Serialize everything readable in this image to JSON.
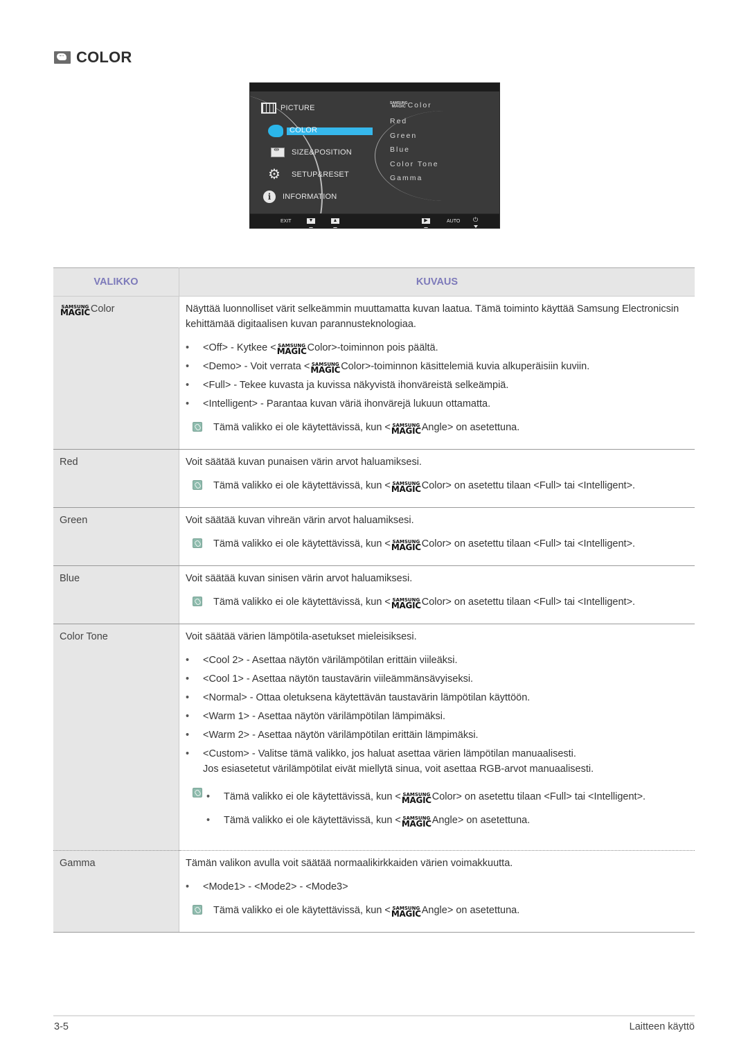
{
  "page": {
    "title": "COLOR",
    "title_icon": "color-palette-icon"
  },
  "osd": {
    "menu_items": [
      {
        "label": "PICTURE",
        "icon": "picture-icon",
        "selected": false
      },
      {
        "label": "COLOR",
        "icon": "color-icon",
        "selected": true
      },
      {
        "label": "SIZE&POSITION",
        "icon": "size-position-icon",
        "selected": false
      },
      {
        "label": "SETUP&RESET",
        "icon": "gear-icon",
        "selected": false
      },
      {
        "label": "INFORMATION",
        "icon": "info-icon",
        "selected": false
      }
    ],
    "submenu_brand_top": "SAMSUNG",
    "submenu_brand_bottom": "MAGIC",
    "submenu_items": [
      "Color",
      "Red",
      "Green",
      "Blue",
      "Color Tone",
      "Gamma"
    ],
    "buttons": {
      "exit": "EXIT",
      "down": "▼",
      "up": "▲",
      "right": "▶",
      "auto": "AUTO",
      "power": "⏻"
    },
    "selected_color": "#36b8ec"
  },
  "brand": {
    "top": "SAMSUNG",
    "bottom": "MAGIC"
  },
  "table": {
    "headers": {
      "menu": "VALIKKO",
      "description": "KUVAUS"
    },
    "header_color": "#7d7aba",
    "rows": [
      {
        "menu": "Color",
        "menu_has_brand": true,
        "intro": "Näyttää luonnolliset värit selkeämmin muuttamatta kuvan laatua. Tämä toiminto käyttää Samsung Electronicsin kehittämää digitaalisen kuvan parannusteknologiaa.",
        "bullets": [
          {
            "before": "<Off> - Kytkee <",
            "after": "Color>-toiminnon pois päältä."
          },
          {
            "before": "<Demo> - Voit verrata <",
            "after": "Color>-toiminnon käsittelemiä kuvia alkuperäisiin kuviin."
          },
          {
            "text": "<Full> - Tekee kuvasta ja kuvissa näkyvistä ihonväreistä selkeämpiä."
          },
          {
            "text": "<Intelligent> - Parantaa kuvan väriä ihonvärejä lukuun ottamatta."
          }
        ],
        "note": {
          "before": "Tämä valikko ei ole käytettävissä, kun <",
          "after": "Angle> on asetettuna."
        }
      },
      {
        "menu": "Red",
        "intro": "Voit säätää kuvan punaisen värin arvot haluamiksesi.",
        "note": {
          "before": "Tämä valikko ei ole käytettävissä, kun <",
          "after": "Color> on asetettu tilaan <Full> tai <Intelligent>."
        }
      },
      {
        "menu": "Green",
        "intro": "Voit säätää kuvan vihreän värin arvot haluamiksesi.",
        "note": {
          "before": "Tämä valikko ei ole käytettävissä, kun <",
          "after": "Color> on asetettu tilaan <Full> tai <Intelligent>."
        }
      },
      {
        "menu": "Blue",
        "intro": "Voit säätää kuvan sinisen värin arvot haluamiksesi.",
        "note": {
          "before": "Tämä valikko ei ole käytettävissä, kun <",
          "after": "Color> on asetettu tilaan <Full> tai <Intelligent>."
        }
      },
      {
        "menu": "Color Tone",
        "intro": "Voit säätää värien lämpötila-asetukset mieleisiksesi.",
        "bullets": [
          {
            "text": "<Cool 2> - Asettaa näytön värilämpötilan erittäin viileäksi."
          },
          {
            "text": "<Cool 1> - Asettaa näytön taustavärin viileämmänsävyiseksi."
          },
          {
            "text": "<Normal> - Ottaa oletuksena käytettävän taustavärin lämpötilan käyttöön."
          },
          {
            "text": "<Warm 1> - Asettaa näytön värilämpötilan lämpimäksi."
          },
          {
            "text": "<Warm 2> - Asettaa näytön värilämpötilan erittäin lämpimäksi."
          },
          {
            "text": "<Custom> - Valitse tämä valikko, jos haluat asettaa värien lämpötilan manuaalisesti.",
            "continuation": "Jos esiasetetut värilämpötilat eivät miellytä sinua, voit asettaa RGB-arvot manuaalisesti."
          }
        ],
        "notes": [
          {
            "before": "Tämä valikko ei ole käytettävissä, kun <",
            "after": "Color> on asetettu tilaan <Full> tai <Intelligent>."
          },
          {
            "before": "Tämä valikko ei ole käytettävissä, kun <",
            "after": "Angle> on asetettuna."
          }
        ]
      },
      {
        "menu": "Gamma",
        "intro": "Tämän valikon avulla voit säätää normaalikirkkaiden värien voimakkuutta.",
        "bullets": [
          {
            "text": "<Mode1> - <Mode2> - <Mode3>"
          }
        ],
        "note": {
          "before": "Tämä valikko ei ole käytettävissä, kun <",
          "after": "Angle> on asetettuna."
        }
      }
    ]
  },
  "footer": {
    "page_number": "3-5",
    "section": "Laitteen käyttö"
  }
}
